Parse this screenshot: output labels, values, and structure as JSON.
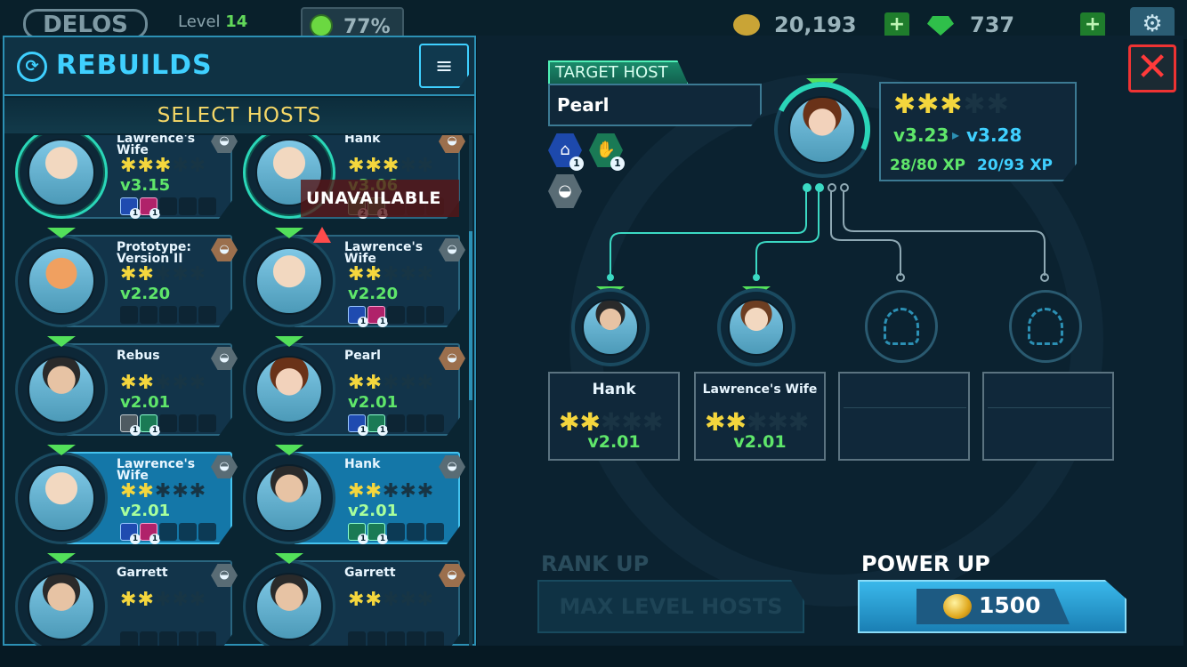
{
  "hud": {
    "logo": "DELOS",
    "level_label": "Level",
    "level_value": "14",
    "mood": "77%",
    "coins": "20,193",
    "gems": "737",
    "plus": "+"
  },
  "left_panel": {
    "title": "REBUILDS",
    "subtitle": "SELECT HOSTS",
    "unavailable": "UNAVAILABLE"
  },
  "host_list": [
    {
      "name": "Lawrence's Wife",
      "version": "v3.15",
      "stars": 3,
      "skills": [
        {
          "color": "blue",
          "count": "1"
        },
        {
          "color": "pink",
          "count": "1"
        }
      ],
      "hat": "gray",
      "selected": false,
      "progress": true
    },
    {
      "name": "Hank",
      "version": "v3.06",
      "stars": 3,
      "skills": [
        {
          "color": "green",
          "count": "2"
        },
        {
          "color": "green",
          "count": "1"
        }
      ],
      "hat": "bronze",
      "selected": false,
      "progress": true,
      "unavailable": true
    },
    {
      "name": "Prototype: Version II",
      "version": "v2.20",
      "stars": 2,
      "skills": [],
      "hat": "bronze",
      "selected": false,
      "robot": true
    },
    {
      "name": "Lawrence's Wife",
      "version": "v2.20",
      "stars": 2,
      "skills": [
        {
          "color": "blue",
          "count": "1"
        },
        {
          "color": "pink",
          "count": "1"
        }
      ],
      "hat": "gray",
      "selected": false
    },
    {
      "name": "Rebus",
      "version": "v2.01",
      "stars": 2,
      "skills": [
        {
          "color": "gray",
          "count": "1"
        },
        {
          "color": "green",
          "count": "1"
        }
      ],
      "hat": "gray",
      "selected": false,
      "male": true
    },
    {
      "name": "Pearl",
      "version": "v2.01",
      "stars": 2,
      "skills": [
        {
          "color": "blue",
          "count": "1"
        },
        {
          "color": "green",
          "count": "1"
        }
      ],
      "hat": "bronze",
      "selected": false,
      "pearl": true
    },
    {
      "name": "Lawrence's Wife",
      "version": "v2.01",
      "stars": 2,
      "skills": [
        {
          "color": "blue",
          "count": "1"
        },
        {
          "color": "pink",
          "count": "1"
        }
      ],
      "hat": "gray",
      "selected": true
    },
    {
      "name": "Hank",
      "version": "v2.01",
      "stars": 2,
      "skills": [
        {
          "color": "green",
          "count": "1"
        },
        {
          "color": "green",
          "count": "1"
        }
      ],
      "hat": "gray",
      "selected": true,
      "male": true
    },
    {
      "name": "Garrett",
      "version": "",
      "stars": 2,
      "skills": [],
      "hat": "gray",
      "selected": false,
      "male": true
    },
    {
      "name": "Garrett",
      "version": "",
      "stars": 2,
      "skills": [],
      "hat": "bronze",
      "selected": false,
      "male": true
    }
  ],
  "target": {
    "tab_label": "TARGET HOST",
    "name": "Pearl",
    "stars": 3,
    "version_now": "v3.23",
    "version_next": "v3.28",
    "xp_now": "28/80 XP",
    "xp_next": "20/93 XP",
    "skills": [
      {
        "color": "blue",
        "count": "1"
      },
      {
        "color": "green",
        "count": "1"
      }
    ]
  },
  "slots": [
    {
      "name": "Hank",
      "stars": 2,
      "version": "v2.01",
      "filled": true
    },
    {
      "name": "Lawrence's Wife",
      "stars": 2,
      "version": "v2.01",
      "filled": true
    },
    {
      "name": "",
      "filled": false
    },
    {
      "name": "",
      "filled": false
    }
  ],
  "actions": {
    "rank_up_label": "RANK UP",
    "rank_up_button": "MAX LEVEL HOSTS",
    "power_up_label": "POWER UP",
    "power_up_cost": "1500"
  },
  "colors": {
    "accent": "#3fd0ff",
    "star": "#f4d63d",
    "version_green": "#5fe66a",
    "close_red": "#ff3a3a"
  },
  "icons": {
    "close": "close-icon",
    "sort": "sort-icon",
    "coin": "coin-icon",
    "gem": "gem-icon",
    "settings": "gear-icon"
  }
}
